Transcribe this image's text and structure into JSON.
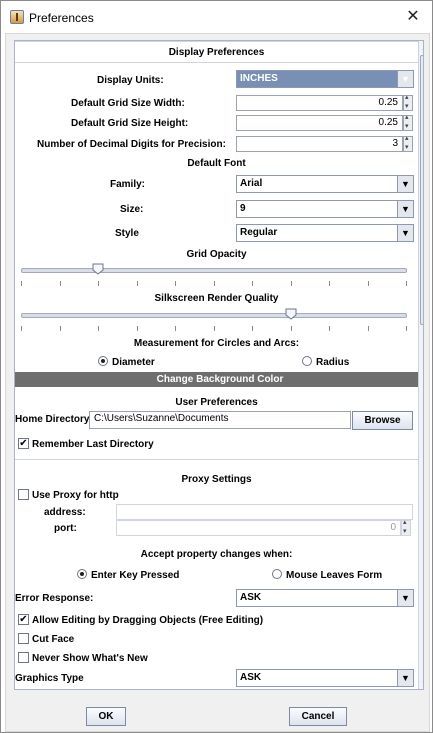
{
  "window": {
    "title": "Preferences",
    "close_glyph": "✕"
  },
  "display": {
    "section_title": "Display Preferences",
    "units_label": "Display Units:",
    "units_value": "INCHES",
    "grid_width_label": "Default Grid Size Width:",
    "grid_width_value": "0.25",
    "grid_height_label": "Default Grid Size Height:",
    "grid_height_value": "0.25",
    "decimal_label": "Number of Decimal Digits for Precision:",
    "decimal_value": "3",
    "font_title": "Default Font",
    "family_label": "Family:",
    "family_value": "Arial",
    "size_label": "Size:",
    "size_value": "9",
    "style_label": "Style",
    "style_value": "Regular",
    "grid_opacity_title": "Grid Opacity",
    "grid_opacity_level": 0.2,
    "silkscreen_title": "Silkscreen Render Quality",
    "silkscreen_level": 0.7,
    "measurement_title": "Measurement for Circles and Arcs:",
    "diameter_label": "Diameter",
    "radius_label": "Radius",
    "measurement_selected": "Diameter",
    "bg_color_button": "Change Background Color"
  },
  "user": {
    "section_title": "User Preferences",
    "home_dir_label": "Home Directory:",
    "home_dir_value": "C:\\Users\\Suzanne\\Documents",
    "browse_label": "Browse",
    "remember_label": "Remember Last Directory",
    "remember_checked": true
  },
  "proxy": {
    "section_title": "Proxy Settings",
    "use_proxy_label": "Use Proxy for http",
    "use_proxy_checked": false,
    "address_label": "address:",
    "address_value": "",
    "port_label": "port:",
    "port_value": "0"
  },
  "accept": {
    "title": "Accept property changes when:",
    "enter_label": "Enter Key Pressed",
    "leave_label": "Mouse Leaves Form",
    "selected": "Enter Key Pressed"
  },
  "misc": {
    "error_label": "Error Response:",
    "error_value": "ASK",
    "allow_editing_label": "Allow Editing by Dragging Objects (Free Editing)",
    "allow_editing_checked": true,
    "cut_face_label": "Cut Face",
    "cut_face_checked": false,
    "never_show_label": "Never Show What's New",
    "never_show_checked": false,
    "graphics_label": "Graphics Type",
    "graphics_value": "ASK"
  },
  "footer": {
    "ok_label": "OK",
    "cancel_label": "Cancel"
  },
  "icons": {
    "dropdown": "chevron-down-icon",
    "app": "java-cup-icon",
    "close": "close-icon"
  }
}
